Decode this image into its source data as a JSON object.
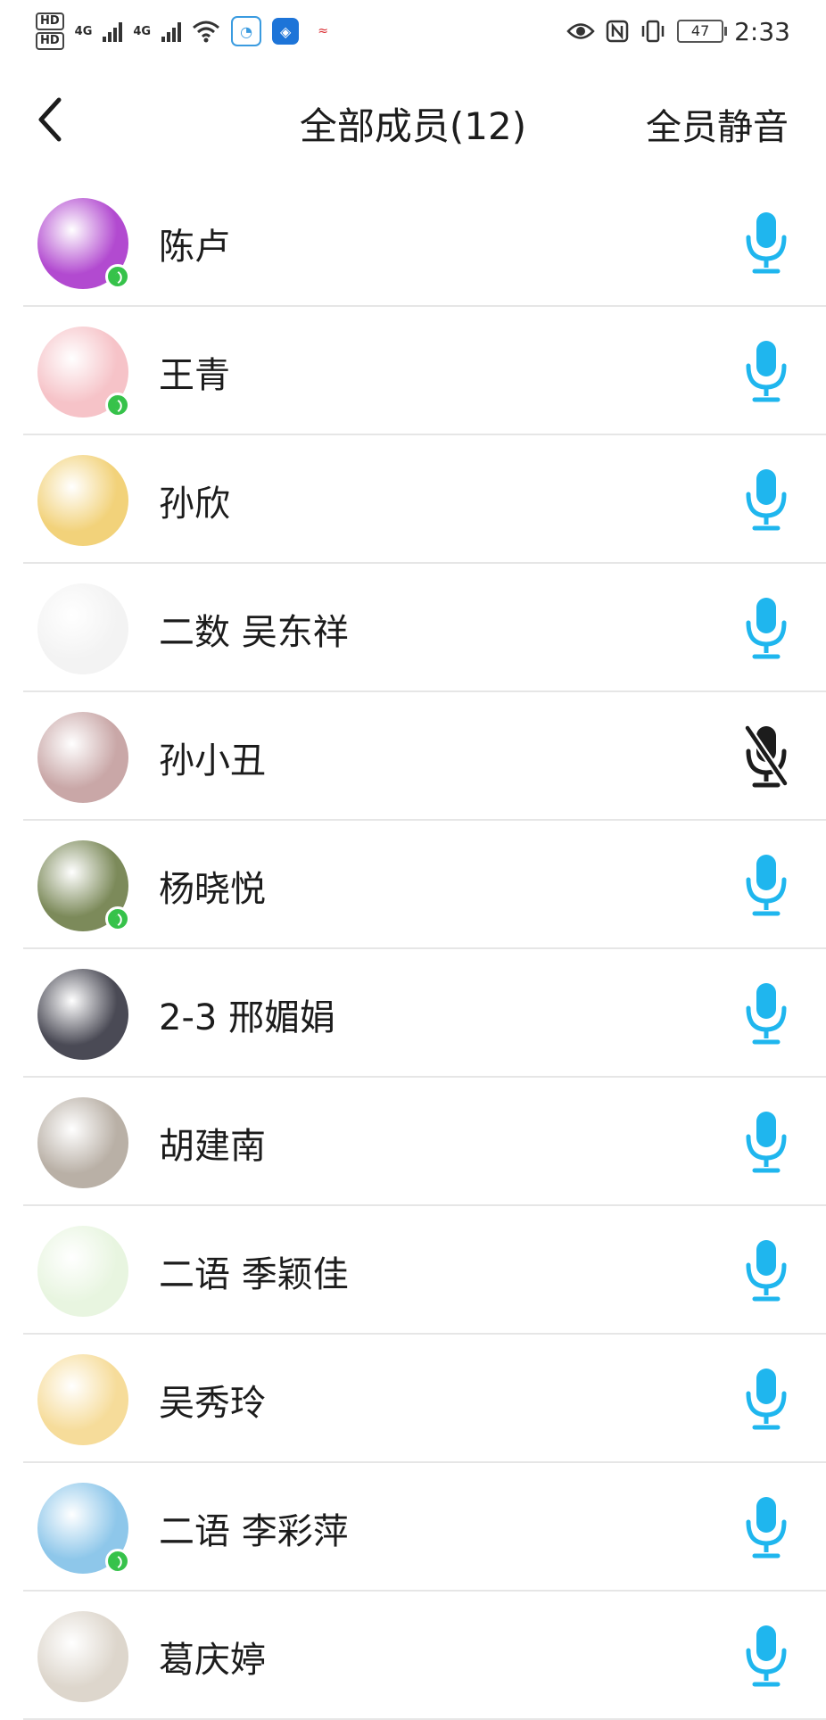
{
  "status_bar": {
    "hd1": "HD",
    "hd2": "HD",
    "net1": "4G",
    "net2": "4G",
    "battery": "47",
    "time": "2:33"
  },
  "header": {
    "title": "全部成员(12)",
    "mute_all": "全员静音"
  },
  "colors": {
    "mic_active": "#1fb6ee",
    "mic_muted": "#1c1c1c",
    "speaking_badge": "#36c24a"
  },
  "members": [
    {
      "name": "陈卢",
      "muted": false,
      "speaking": true,
      "avatar_color": "#b24ad0"
    },
    {
      "name": "王青",
      "muted": false,
      "speaking": true,
      "avatar_color": "#f6c3c8"
    },
    {
      "name": "孙欣",
      "muted": false,
      "speaking": false,
      "avatar_color": "#f2d27a"
    },
    {
      "name": "二数 吴东祥",
      "muted": false,
      "speaking": false,
      "avatar_color": "#f3f3f3"
    },
    {
      "name": "孙小丑",
      "muted": true,
      "speaking": false,
      "avatar_color": "#c9a7a7"
    },
    {
      "name": "杨晓悦",
      "muted": false,
      "speaking": true,
      "avatar_color": "#7c8a5a"
    },
    {
      "name": "2-3 邢媚娟",
      "muted": false,
      "speaking": false,
      "avatar_color": "#4a4a55"
    },
    {
      "name": "胡建南",
      "muted": false,
      "speaking": false,
      "avatar_color": "#b9b0a6"
    },
    {
      "name": "二语 季颖佳",
      "muted": false,
      "speaking": false,
      "avatar_color": "#e8f5e0"
    },
    {
      "name": "吴秀玲",
      "muted": false,
      "speaking": false,
      "avatar_color": "#f6dc9a"
    },
    {
      "name": "二语 李彩萍",
      "muted": false,
      "speaking": true,
      "avatar_color": "#8ec7ea"
    },
    {
      "name": "葛庆婷",
      "muted": false,
      "speaking": false,
      "avatar_color": "#ddd6cc"
    }
  ]
}
